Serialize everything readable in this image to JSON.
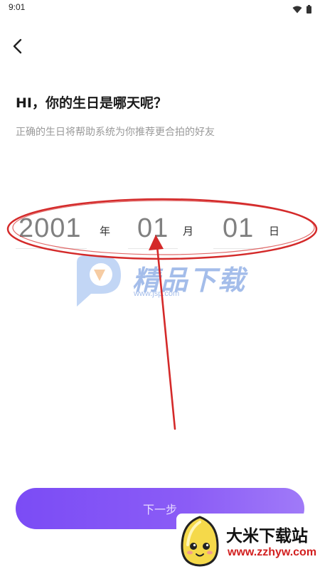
{
  "status_bar": {
    "time": "9:01",
    "icons": [
      "wifi-icon",
      "battery-icon"
    ]
  },
  "header": {
    "back_icon": "chevron-left-icon"
  },
  "content": {
    "title": "HI，你的生日是哪天呢？",
    "subtitle": "正确的生日将帮助系统为你推荐更合拍的好友"
  },
  "date_picker": {
    "year": "2001",
    "year_unit": "年",
    "month": "01",
    "month_unit": "月",
    "day": "01",
    "day_unit": "日"
  },
  "watermark": {
    "text": "精品下载",
    "url": "www.jsp.com"
  },
  "footer": {
    "next_label": "下一步"
  },
  "site_badge": {
    "name": "大米下载站",
    "url": "www.zzhyw.com"
  },
  "colors": {
    "accent_start": "#7b4cf5",
    "accent_end": "#a07af8",
    "annotation_red": "#d42a2a",
    "subtitle_gray": "#9a9a9a"
  }
}
